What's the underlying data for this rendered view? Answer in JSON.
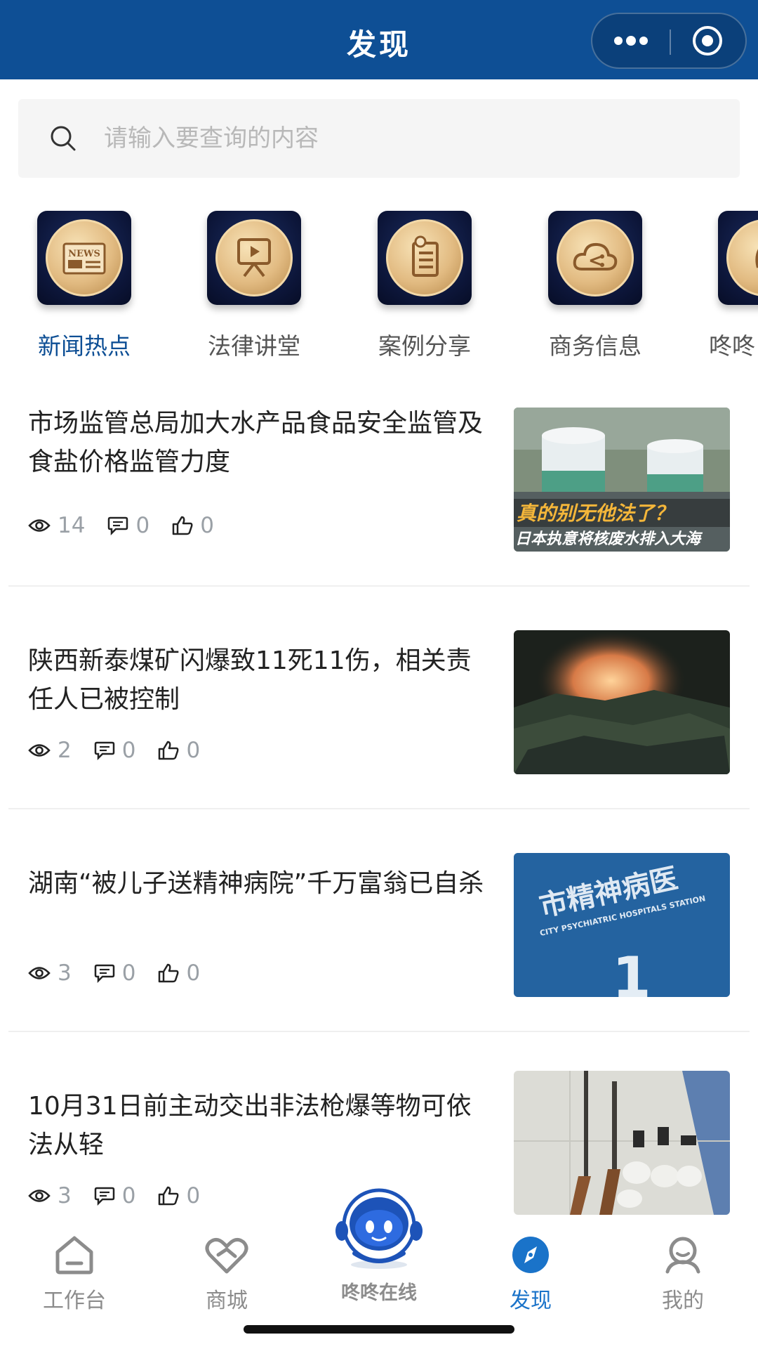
{
  "header": {
    "title": "发现"
  },
  "search": {
    "placeholder": "请输入要查询的内容"
  },
  "categories": [
    {
      "label": "新闻热点",
      "icon": "news-icon",
      "active": true
    },
    {
      "label": "法律讲堂",
      "icon": "video-lecture-icon",
      "active": false
    },
    {
      "label": "案例分享",
      "icon": "document-list-icon",
      "active": false
    },
    {
      "label": "商务信息",
      "icon": "cloud-network-icon",
      "active": false
    },
    {
      "label": "咚咚",
      "icon": "emblem-icon",
      "active": false
    }
  ],
  "news": [
    {
      "title": "市场监管总局加大水产品食品安全监管及食盐价格监管力度",
      "views": "14",
      "comments": "0",
      "likes": "0",
      "thumb_caption_1": "真的别无他法了？",
      "thumb_caption_2": "日本执意将核废水排入大海"
    },
    {
      "title": "陕西新泰煤矿闪爆致11死11伤，相关责任人已被控制",
      "views": "2",
      "comments": "0",
      "likes": "0"
    },
    {
      "title": "湖南“被儿子送精神病院”千万富翁已自杀",
      "views": "3",
      "comments": "0",
      "likes": "0",
      "thumb_caption_1": "市精神病医",
      "thumb_caption_2": "CITY PSYCHIATRIC HOSPITALS STATION",
      "thumb_caption_3": "1"
    },
    {
      "title": "10月31日前主动交出非法枪爆等物可依法从轻",
      "views": "3",
      "comments": "0",
      "likes": "0"
    }
  ],
  "tabbar": {
    "workbench": "工作台",
    "mall": "商城",
    "online": "咚咚在线",
    "discover": "发现",
    "mine": "我的"
  },
  "colors": {
    "header": "#0e4f95",
    "active_tab": "#1a73c9",
    "active_category": "#0e4f95"
  }
}
